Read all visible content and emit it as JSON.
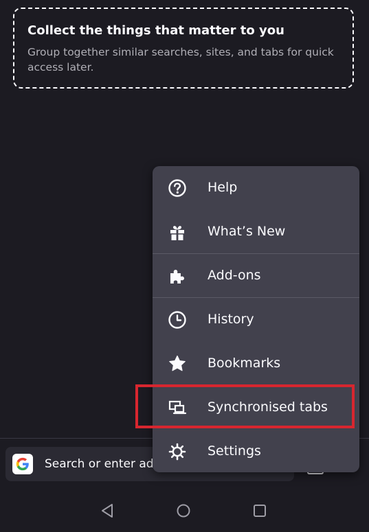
{
  "collections": {
    "title": "Collect the things that matter to you",
    "description": "Group together similar searches, sites, and tabs for quick access later."
  },
  "toolbar": {
    "search_placeholder": "Search or enter ad",
    "search_engine_icon": "google-logo"
  },
  "menu": {
    "items": [
      {
        "label": "Help",
        "icon": "help-icon"
      },
      {
        "label": "What’s New",
        "icon": "gift-icon"
      },
      {
        "label": "Add-ons",
        "icon": "puzzle-icon"
      },
      {
        "label": "History",
        "icon": "clock-icon"
      },
      {
        "label": "Bookmarks",
        "icon": "star-icon"
      },
      {
        "label": "Synchronised tabs",
        "icon": "synced-devices-icon"
      },
      {
        "label": "Settings",
        "icon": "gear-icon"
      }
    ]
  },
  "nav_bar": {
    "buttons": [
      "back-icon",
      "home-icon",
      "recents-icon"
    ]
  },
  "colors": {
    "background": "#1c1b22",
    "menu_background": "#42414d",
    "highlight": "#d7262f"
  }
}
